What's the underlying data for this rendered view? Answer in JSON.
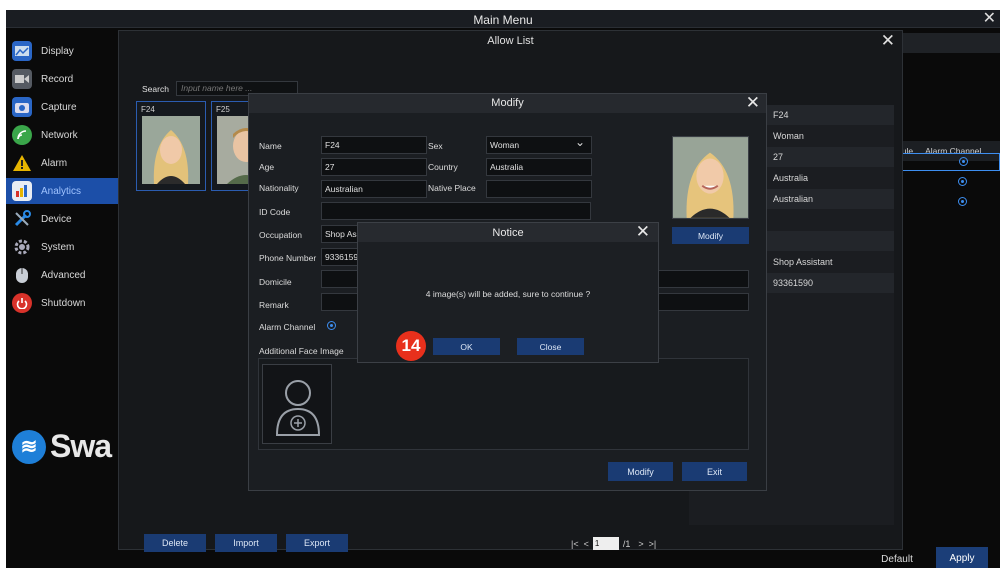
{
  "main_menu": {
    "title": "Main Menu",
    "close_icon": "close-icon"
  },
  "sidebar": {
    "items": [
      {
        "label": "Display",
        "icon": "display-icon",
        "color": "#2a66c6"
      },
      {
        "label": "Record",
        "icon": "record-icon",
        "color": "#555a62"
      },
      {
        "label": "Capture",
        "icon": "capture-icon",
        "color": "#2a66c6"
      },
      {
        "label": "Network",
        "icon": "network-icon",
        "color": "#3aa64a"
      },
      {
        "label": "Alarm",
        "icon": "alarm-icon",
        "color": "#e6b400"
      },
      {
        "label": "Analytics",
        "icon": "analytics-icon",
        "color": "#2a66c6",
        "active": true
      },
      {
        "label": "Device",
        "icon": "device-icon",
        "color": "#2a66c6"
      },
      {
        "label": "System",
        "icon": "system-icon",
        "color": "#8a8f96"
      },
      {
        "label": "Advanced",
        "icon": "advanced-icon",
        "color": "#b9bec5"
      },
      {
        "label": "Shutdown",
        "icon": "shutdown-icon",
        "color": "#d8322a"
      }
    ]
  },
  "brand": {
    "text": "Swa"
  },
  "allow_list": {
    "title": "Allow List",
    "search_label": "Search",
    "search_placeholder": "Input name here ...",
    "thumbnails": [
      {
        "id": "F24"
      },
      {
        "id": "F25"
      }
    ],
    "table_rows": [
      "F24",
      "Woman",
      "27",
      "Australia",
      "Australian",
      "",
      "",
      "Shop Assistant",
      "93361590"
    ],
    "buttons": {
      "delete": "Delete",
      "import": "Import",
      "export": "Export"
    },
    "pager": {
      "first": "|<",
      "prev": "<",
      "page": "1",
      "total": "/1",
      "next": ">",
      "last": ">|"
    }
  },
  "background": {
    "col_schedule": "dule",
    "col_alarm_channel": "Alarm Channel",
    "default_label": "Default",
    "apply_label": "Apply"
  },
  "modify": {
    "title": "Modify",
    "labels": {
      "name": "Name",
      "age": "Age",
      "nationality": "Nationality",
      "id_code": "ID Code",
      "occupation": "Occupation",
      "phone": "Phone Number",
      "domicile": "Domicile",
      "remark": "Remark",
      "alarm_channel": "Alarm Channel",
      "additional_face": "Additional Face Image",
      "sex": "Sex",
      "country": "Country",
      "native_place": "Native Place"
    },
    "values": {
      "name": "F24",
      "age": "27",
      "nationality": "Australian",
      "id_code": "",
      "occupation": "Shop As",
      "phone": "9336159",
      "domicile": "",
      "remark": "",
      "sex": "Woman",
      "country": "Australia",
      "native_place": ""
    },
    "photo_modify": "Modify",
    "modify_button": "Modify",
    "exit_button": "Exit"
  },
  "notice": {
    "title": "Notice",
    "message": "4 image(s) will be added, sure to continue ?",
    "ok": "OK",
    "close": "Close"
  },
  "step_badge": "14"
}
